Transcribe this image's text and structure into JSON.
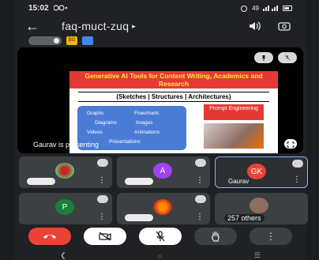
{
  "status": {
    "time": "15:02",
    "right_info": "49"
  },
  "header": {
    "title": "faq-muct-zuq",
    "back_icon": "back-arrow-icon",
    "speaker_icon": "speaker-icon",
    "camera_switch_icon": "camera-flip-icon"
  },
  "chips": {
    "badge_text": "BG"
  },
  "slide": {
    "title": "Generative AI Tools for Content Writing, Academics and Research",
    "subtitle": "(Sketches | Structures | Architectures)",
    "items": [
      "Graphs",
      "Flowcharts",
      "Diagrams",
      "Images",
      "Videos",
      "Animations",
      "Presentations"
    ],
    "callout": "Prompt Engineering"
  },
  "stage": {
    "presenting_label": "Gaurav is presenting"
  },
  "tiles": {
    "t2_initial": "A",
    "t3_initial": "GK",
    "t3_name": "Gaurav",
    "t4_initial": "P",
    "t6_label": "257 others"
  },
  "colors": {
    "end_call": "#ea4335",
    "avatar_gk": "#ea4335",
    "avatar_a": "#a142f4",
    "avatar_p": "#188038",
    "accent": "#8ab4f8"
  }
}
